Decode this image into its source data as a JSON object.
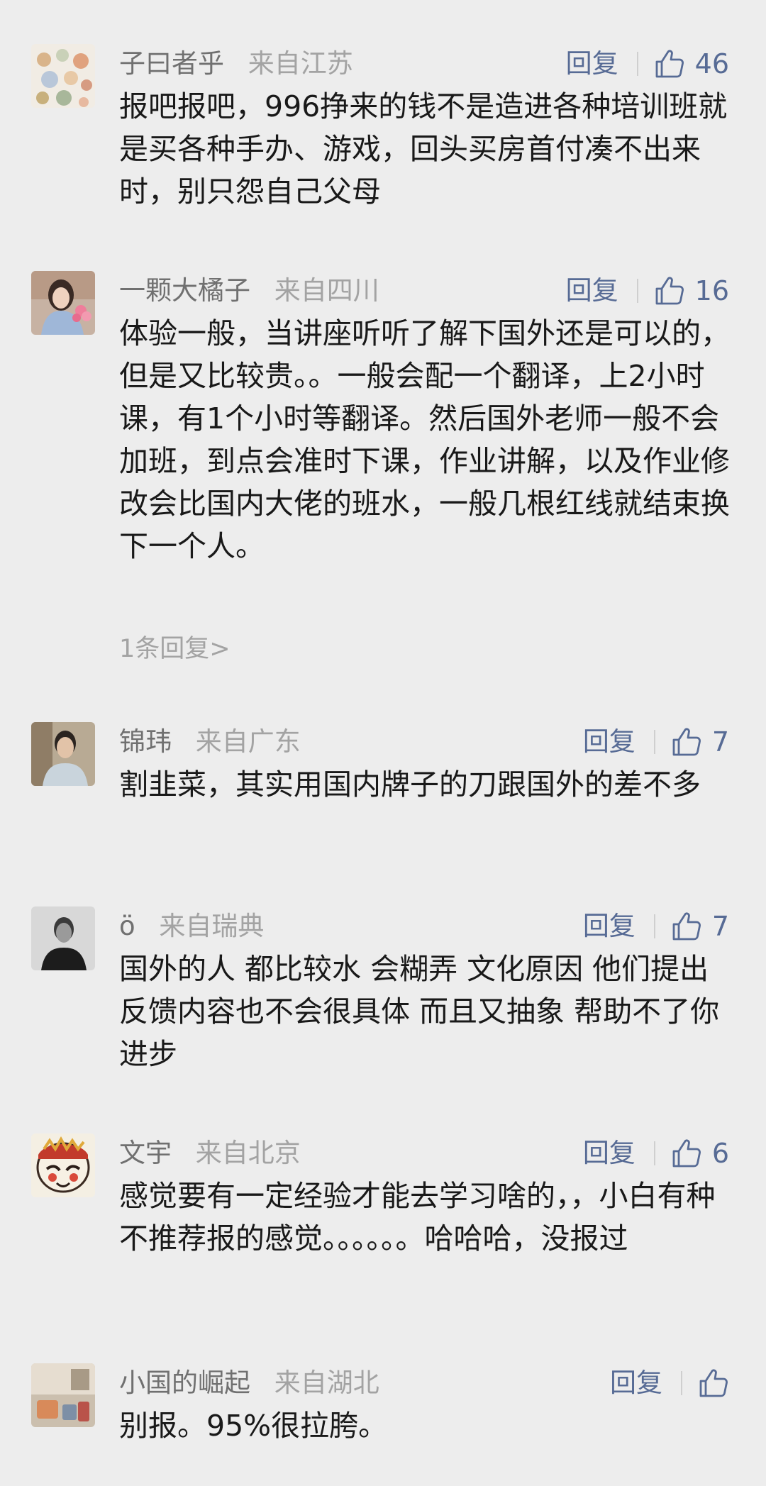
{
  "reply_label": "回复",
  "comments": [
    {
      "name": "子曰者乎",
      "location": "来自江苏",
      "likes": "46",
      "text": "报吧报吧，996挣来的钱不是造进各种培训班就是买各种手办、游戏，回头买房首付凑不出来时，别只怨自己父母"
    },
    {
      "name": "一颗大橘子",
      "location": "来自四川",
      "likes": "16",
      "text": "体验一般，当讲座听听了解下国外还是可以的，但是又比较贵。。一般会配一个翻译，上2小时课，有1个小时等翻译。然后国外老师一般不会加班，到点会准时下课，作业讲解，以及作业修改会比国内大佬的班水，一般几根红线就结束换下一个人。",
      "replies_link": "1条回复>"
    },
    {
      "name": "锦玮",
      "location": "来自广东",
      "likes": "7",
      "text": "割韭菜，其实用国内牌子的刀跟国外的差不多"
    },
    {
      "name": "ö",
      "location": "来自瑞典",
      "likes": "7",
      "text": "国外的人 都比较水 会糊弄 文化原因 他们提出反馈内容也不会很具体 而且又抽象 帮助不了你进步"
    },
    {
      "name": "文宇",
      "location": "来自北京",
      "likes": "6",
      "text": "感觉要有一定经验才能去学习啥的，，小白有种不推荐报的感觉。。。。。。哈哈哈，没报过"
    },
    {
      "name": "小国的崛起",
      "location": "来自湖北",
      "likes": "",
      "text": "别报。95%很拉胯。"
    }
  ]
}
